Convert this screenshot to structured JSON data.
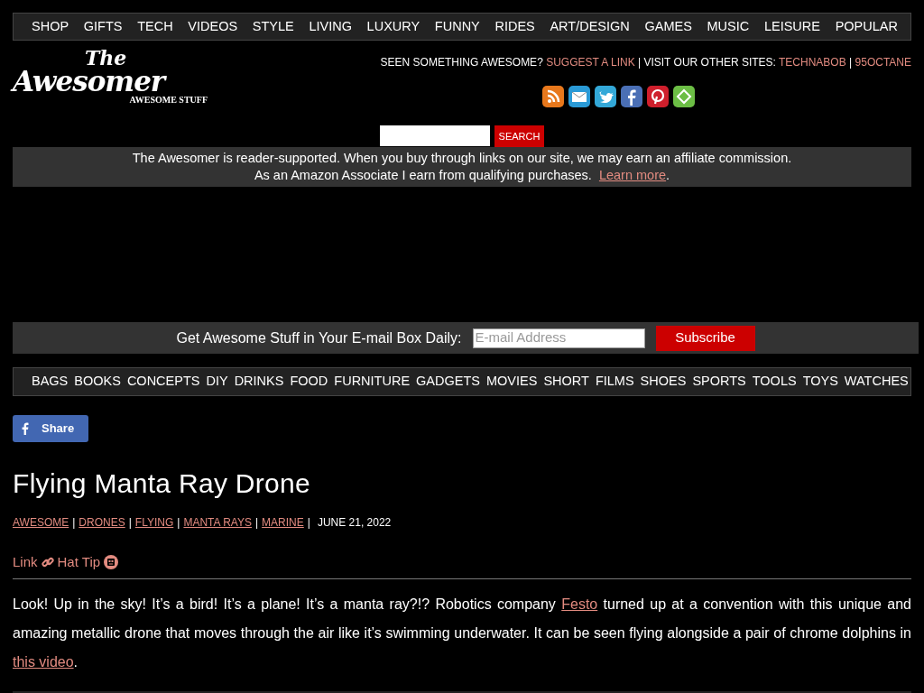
{
  "top_nav": [
    "SHOP",
    "GIFTS",
    "TECH",
    "VIDEOS",
    "STYLE",
    "LIVING",
    "LUXURY",
    "FUNNY",
    "RIDES",
    "ART/DESIGN",
    "GAMES",
    "MUSIC",
    "LEISURE",
    "POPULAR"
  ],
  "logo": {
    "top": "The",
    "main": "Awesomer",
    "tagline": "AWESOME STUFF"
  },
  "header_line": [
    {
      "kind": "text",
      "text": "SEEN SOMETHING AWESOME?"
    },
    {
      "kind": "link",
      "text": "SUGGEST A LINK"
    },
    {
      "kind": "text",
      "text": "| VISIT OUR OTHER SITES:"
    },
    {
      "kind": "link",
      "text": "TECHNABOB"
    },
    {
      "kind": "text",
      "text": "|"
    },
    {
      "kind": "link",
      "text": "95OCTANE"
    }
  ],
  "social_icons": [
    {
      "kind": "rss"
    },
    {
      "kind": "email"
    },
    {
      "kind": "twitter"
    },
    {
      "kind": "facebook"
    },
    {
      "kind": "pinterest"
    },
    {
      "kind": "feedly"
    }
  ],
  "search": {
    "button": "SEARCH"
  },
  "disclaimer": {
    "line1": "The Awesomer is reader-supported. When you buy through links on our site, we may earn an affiliate commission.",
    "line2": "As an Amazon Associate I earn from qualifying purchases.",
    "link": "Learn more",
    "end": "."
  },
  "newsletter": {
    "label": "Get Awesome Stuff in Your E-mail Box Daily:",
    "placeholder": "E-mail Address",
    "button": "Subscribe"
  },
  "category_nav": [
    "BAGS",
    "BOOKS",
    "CONCEPTS",
    "DIY",
    "DRINKS",
    "FOOD",
    "FURNITURE",
    "GADGETS",
    "MOVIES",
    "SHORT",
    "FILMS",
    "SHOES",
    "SPORTS",
    "TOOLS",
    "TOYS",
    "WATCHES"
  ],
  "share_button": "Share",
  "article": {
    "title": "Flying Manta Ray Drone",
    "meta": [
      {
        "kind": "link",
        "text": "AWESOME"
      },
      {
        "kind": "sep",
        "text": "|"
      },
      {
        "kind": "link",
        "text": "DRONES"
      },
      {
        "kind": "sep",
        "text": "|"
      },
      {
        "kind": "link",
        "text": "FLYING"
      },
      {
        "kind": "sep",
        "text": "|"
      },
      {
        "kind": "link",
        "text": "MANTA RAYS"
      },
      {
        "kind": "sep",
        "text": "|"
      },
      {
        "kind": "link",
        "text": "MARINE"
      },
      {
        "kind": "sep",
        "text": "|"
      },
      {
        "kind": "date",
        "text": "JUNE 21, 2022"
      }
    ],
    "actions": [
      {
        "kind": "link",
        "label": "Link"
      },
      {
        "kind": "hattip",
        "label": "Hat Tip"
      }
    ],
    "body": [
      {
        "kind": "text",
        "text": "Look! Up in the sky! It’s a bird! It’s a plane! It’s a manta ray?!? Robotics company "
      },
      {
        "kind": "link",
        "text": "Festo"
      },
      {
        "kind": "text",
        "text": " turned up at a convention with this unique and amazing metallic drone that moves through the air like it’s swimming underwater. It can be seen flying alongside a pair of chrome dolphins in "
      },
      {
        "kind": "link",
        "text": "this video"
      },
      {
        "kind": "text",
        "text": "."
      }
    ]
  }
}
